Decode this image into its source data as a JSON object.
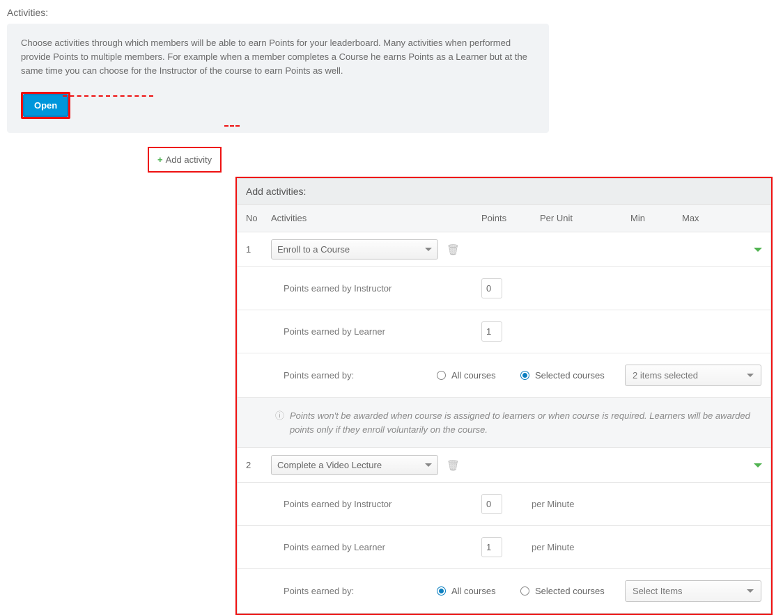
{
  "section_title": "Activities:",
  "info_text": "Choose activities through which members will be able to earn Points for your leaderboard. Many activities when performed provide Points to multiple members. For example when a member completes a Course he earns Points as a Learner but at the same time you can choose for the Instructor of the course to earn Points as well.",
  "open_button": "Open",
  "add_activity_label": "Add activity",
  "panel_title": "Add activities:",
  "headers": {
    "no": "No",
    "activities": "Activities",
    "points": "Points",
    "per_unit": "Per Unit",
    "min": "Min",
    "max": "Max"
  },
  "activities": [
    {
      "no": "1",
      "name": "Enroll to a Course",
      "instructor_label": "Points earned by Instructor",
      "instructor_points": "0",
      "learner_label": "Points earned by Learner",
      "learner_points": "1",
      "earned_by_label": "Points earned by:",
      "all_courses_label": "All courses",
      "selected_courses_label": "Selected courses",
      "scope": "selected",
      "selected_items_text": "2 items selected",
      "note": "Points won't be awarded when course is assigned to learners or when course is required. Learners will be awarded points only if they enroll voluntarily on the course."
    },
    {
      "no": "2",
      "name": "Complete a Video Lecture",
      "instructor_label": "Points earned by Instructor",
      "instructor_points": "0",
      "instructor_unit": "per Minute",
      "learner_label": "Points earned by Learner",
      "learner_points": "1",
      "learner_unit": "per Minute",
      "earned_by_label": "Points earned by:",
      "all_courses_label": "All courses",
      "selected_courses_label": "Selected courses",
      "scope": "all",
      "selected_items_text": "Select Items"
    }
  ]
}
